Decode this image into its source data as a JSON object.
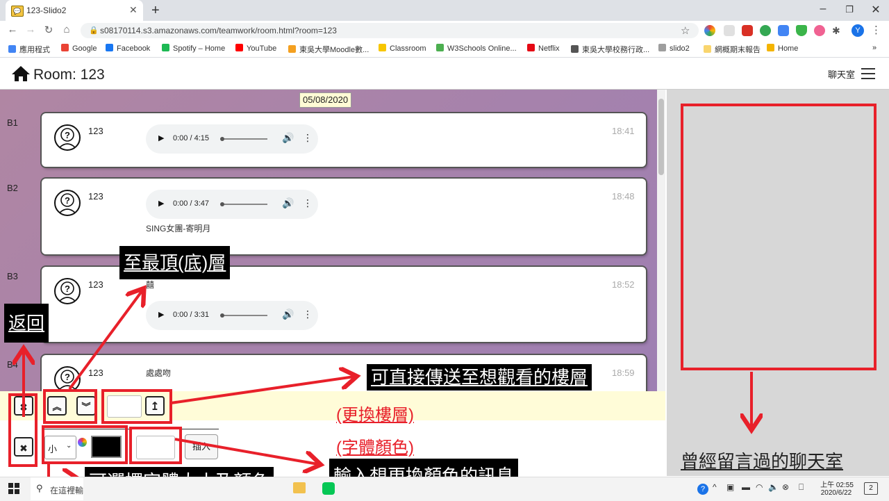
{
  "browser": {
    "tab_title": "123-Slido2",
    "tab_favicon": "💬",
    "url": "s08170114.s3.amazonaws.com/teamwork/room.html?room=123",
    "profile_initial": "Y",
    "bookmarks": [
      {
        "label": "應用程式",
        "color": "#4285f4"
      },
      {
        "label": "Google",
        "color": "#ea4335"
      },
      {
        "label": "Facebook",
        "color": "#1877f2"
      },
      {
        "label": "Spotify – Home",
        "color": "#1db954"
      },
      {
        "label": "YouTube",
        "color": "#ff0000"
      },
      {
        "label": "東吳大學Moodle數...",
        "color": "#f4a020"
      },
      {
        "label": "Classroom",
        "color": "#f7c600"
      },
      {
        "label": "W3Schools Online...",
        "color": "#4caf50"
      },
      {
        "label": "Netflix",
        "color": "#e50914"
      },
      {
        "label": "東吳大學校務行政...",
        "color": "#555555"
      },
      {
        "label": "slido2",
        "color": "#9e9e9e"
      },
      {
        "label": "網概期末報告",
        "color": "#f9d56e"
      },
      {
        "label": "Home",
        "color": "#f4b400"
      }
    ],
    "more": "»"
  },
  "page": {
    "room_title": "Room: 123",
    "chat_label": "聊天室",
    "date": "05/08/2020"
  },
  "posts": [
    {
      "floor": "B1",
      "user": "123",
      "audio_time": "0:00 / 4:15",
      "time": "18:41",
      "message": ""
    },
    {
      "floor": "B2",
      "user": "123",
      "audio_time": "0:00 / 3:47",
      "time": "18:48",
      "message": "SING女團-寄明月"
    },
    {
      "floor": "B3",
      "user": "123",
      "audio_time": "0:00 / 3:31",
      "time": "18:52",
      "message": "囍"
    },
    {
      "floor": "B4",
      "user": "123",
      "audio_time": "",
      "time": "18:59",
      "message": "處處吻"
    }
  ],
  "toolbar": {
    "close_glyph": "✖",
    "top_glyph": "≪",
    "bottom_glyph": "≫",
    "go_glyph": "↥",
    "size_selected": "小",
    "insert_label": "插入",
    "text_color": "#000000"
  },
  "annotations": {
    "back": "返回",
    "top_bottom": "至最頂(底)層",
    "goto_floor": "可直接傳送至想觀看的樓層",
    "change_floor": "(更換樓層)",
    "font_color": "(字體顏色)",
    "size_color": "可選擇字體大小及顏色",
    "input_message": "輸入想更換顏色的訊息",
    "past_rooms": "曾經留言過的聊天室"
  },
  "taskbar": {
    "search_placeholder": "在這裡輸入文字來搜尋",
    "clock_time": "上午 02:55",
    "clock_date": "2020/6/22",
    "notify_count": "2"
  },
  "colors": {
    "annotation_red": "#e8202a",
    "chat_bg": "#a882aa",
    "date_bg": "#fffbd5"
  }
}
